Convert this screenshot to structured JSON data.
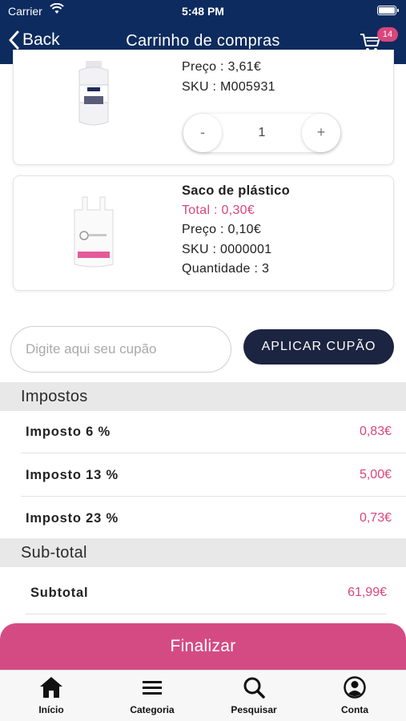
{
  "status_bar": {
    "carrier": "Carrier",
    "time": "5:48 PM"
  },
  "nav": {
    "back_label": "Back",
    "title": "Carrinho de compras",
    "cart_count": "14"
  },
  "products": [
    {
      "price": "Preço : 3,61€",
      "sku": "SKU : M005931",
      "quantity": "1",
      "minus_label": "-",
      "plus_label": "+"
    },
    {
      "name": "Saco de plástico",
      "total": "Total : 0,30€",
      "price": "Preço : 0,10€",
      "sku": "SKU : 0000001",
      "quantity": "Quantidade : 3"
    }
  ],
  "coupon": {
    "placeholder": "Digite aqui seu cupão",
    "button_label": "APLICAR CUPÃO"
  },
  "taxes": {
    "heading": "Impostos",
    "rows": [
      {
        "label": "Imposto 6 %",
        "value": "0,83€"
      },
      {
        "label": "Imposto 13 %",
        "value": "5,00€"
      },
      {
        "label": "Imposto 23 %",
        "value": "0,73€"
      }
    ]
  },
  "subtotal": {
    "heading": "Sub-total",
    "label": "Subtotal",
    "value": "61,99€"
  },
  "finalize_label": "Finalizar",
  "tabs": [
    {
      "label": "Início",
      "icon": "home-icon"
    },
    {
      "label": "Categoria",
      "icon": "menu-icon"
    },
    {
      "label": "Pesquisar",
      "icon": "search-icon"
    },
    {
      "label": "Conta",
      "icon": "account-icon"
    }
  ],
  "colors": {
    "nav_bg": "#0d2b5e",
    "accent": "#d9457c",
    "coupon_button": "#1b2440"
  }
}
